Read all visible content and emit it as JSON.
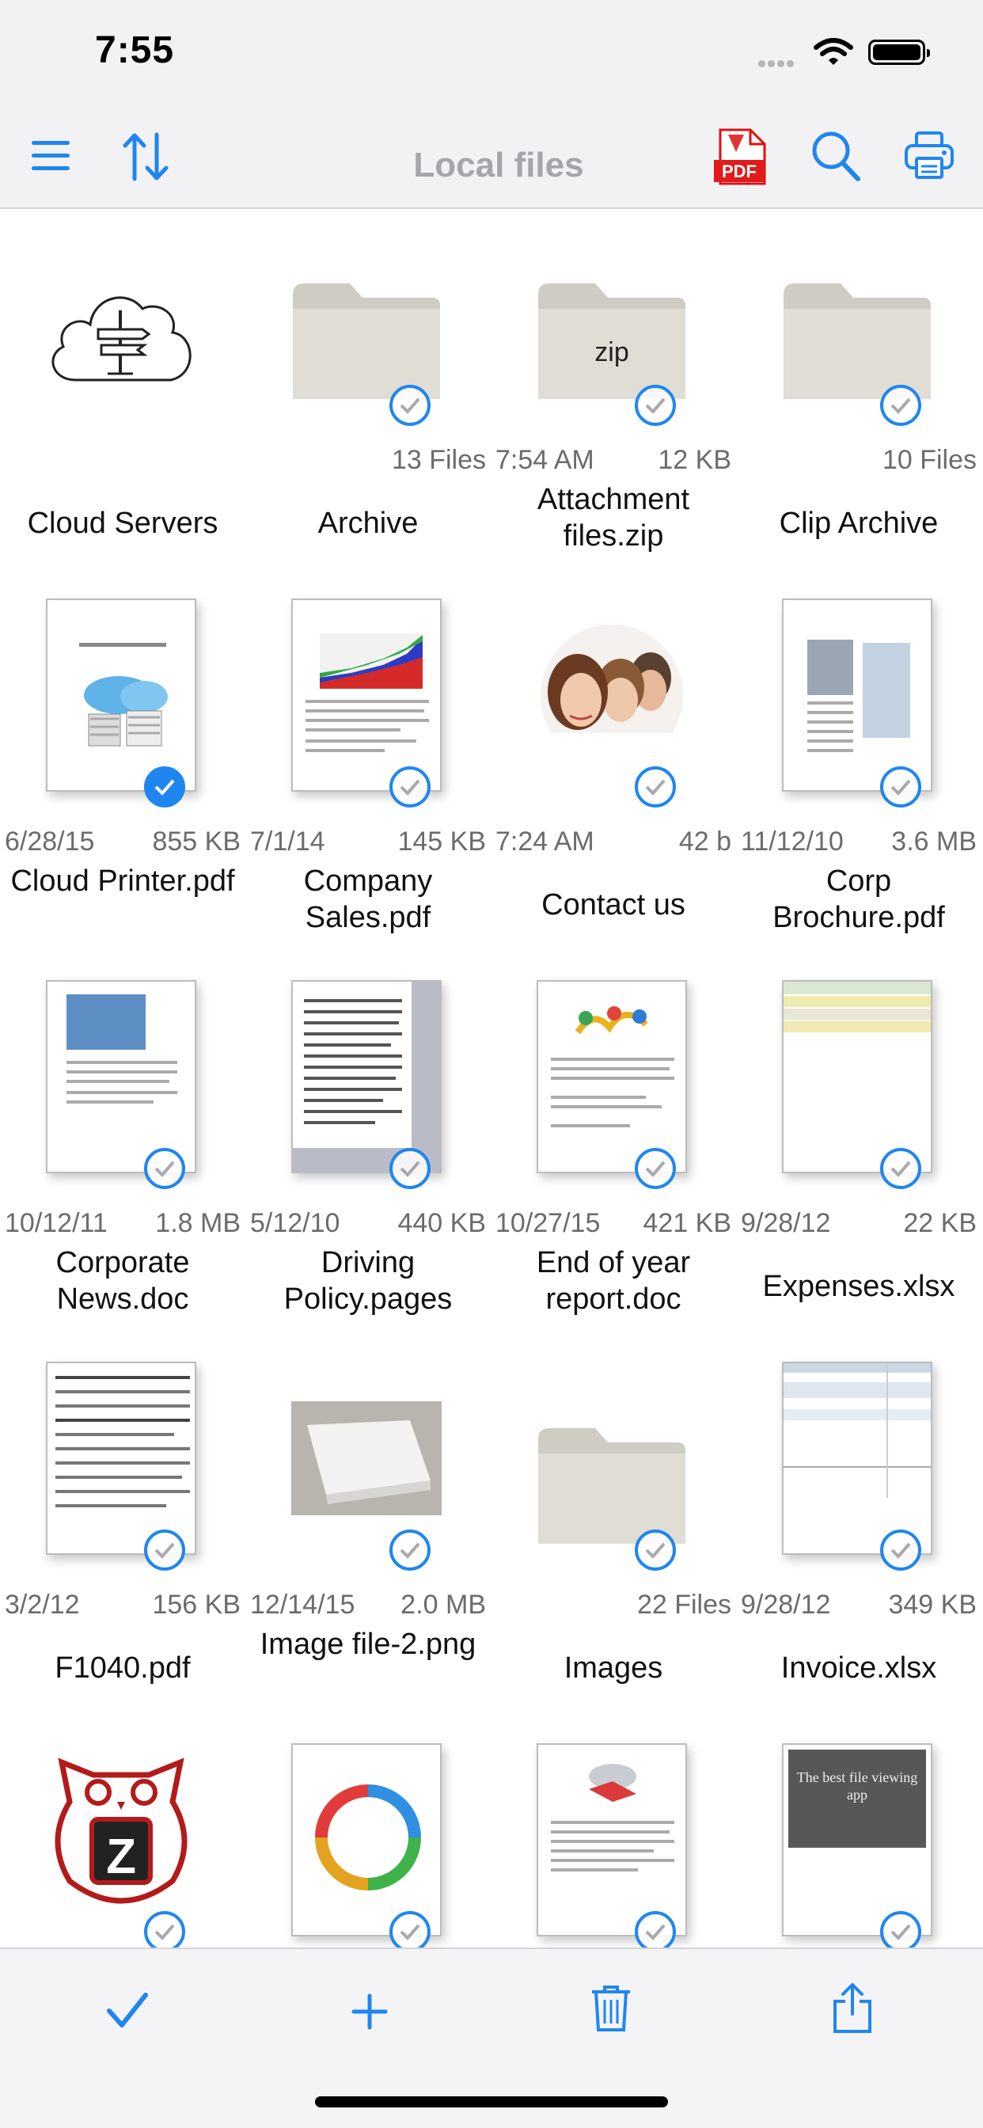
{
  "status_bar": {
    "time": "7:55"
  },
  "navbar": {
    "title": "Local files",
    "left_icons": [
      "menu-icon",
      "sort-icon"
    ],
    "right_icons": [
      "pdf-icon",
      "search-icon",
      "print-icon"
    ],
    "accent_color": "#1f86f0"
  },
  "files": [
    {
      "name": "Cloud Servers",
      "left": "",
      "right": "",
      "kind": "cloud",
      "checked": null
    },
    {
      "name": "Archive",
      "left": "",
      "right": "13 Files",
      "kind": "folder",
      "checked": false
    },
    {
      "name": "Attachment files.zip",
      "left": "7:54 AM",
      "right": "12 KB",
      "kind": "zip",
      "zip_label": "zip",
      "checked": false
    },
    {
      "name": "Clip Archive",
      "left": "",
      "right": "10 Files",
      "kind": "folder",
      "checked": false
    },
    {
      "name": "Cloud Printer.pdf",
      "left": "6/28/15",
      "right": "855 KB",
      "kind": "doc",
      "checked": true
    },
    {
      "name": "Company Sales.pdf",
      "left": "7/1/14",
      "right": "145 KB",
      "kind": "doc",
      "checked": false
    },
    {
      "name": "Contact us",
      "left": "7:24 AM",
      "right": "42 b",
      "kind": "photo",
      "checked": false
    },
    {
      "name": "Corp Brochure.pdf",
      "left": "11/12/10",
      "right": "3.6 MB",
      "kind": "doc",
      "checked": false
    },
    {
      "name": "Corporate News.doc",
      "left": "10/12/11",
      "right": "1.8 MB",
      "kind": "doc",
      "checked": false
    },
    {
      "name": "Driving Policy.pages",
      "left": "5/12/10",
      "right": "440 KB",
      "kind": "doc",
      "checked": false
    },
    {
      "name": "End of year report.doc",
      "left": "10/27/15",
      "right": "421 KB",
      "kind": "doc",
      "checked": false
    },
    {
      "name": "Expenses.xlsx",
      "left": "9/28/12",
      "right": "22 KB",
      "kind": "sheet",
      "checked": false
    },
    {
      "name": "F1040.pdf",
      "left": "3/2/12",
      "right": "156 KB",
      "kind": "doc",
      "checked": false
    },
    {
      "name": "Image file-2.png",
      "left": "12/14/15",
      "right": "2.0 MB",
      "kind": "image",
      "checked": false
    },
    {
      "name": "Images",
      "left": "",
      "right": "22 Files",
      "kind": "folder",
      "checked": false
    },
    {
      "name": "Invoice.xlsx",
      "left": "9/28/12",
      "right": "349 KB",
      "kind": "sheet",
      "checked": false
    },
    {
      "name": "",
      "left": "",
      "right": "",
      "kind": "owl",
      "logo_letter": "Z",
      "checked": false
    },
    {
      "name": "",
      "left": "",
      "right": "",
      "kind": "cycle",
      "checked": false
    },
    {
      "name": "",
      "left": "",
      "right": "",
      "kind": "doc",
      "checked": false
    },
    {
      "name": "",
      "left": "",
      "right": "",
      "kind": "dark",
      "dark_text": "The best file viewing app",
      "checked": false
    }
  ],
  "toolbar": {
    "icons": [
      "checkmark-icon",
      "add-icon",
      "trash-icon",
      "share-icon"
    ]
  }
}
